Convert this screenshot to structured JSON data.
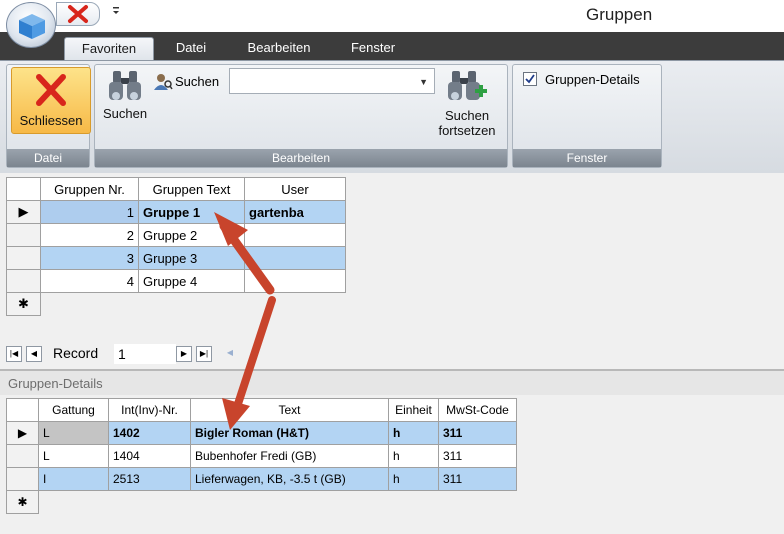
{
  "window": {
    "title": "Gruppen"
  },
  "tabs": [
    {
      "label": "Favoriten",
      "active": true
    },
    {
      "label": "Datei",
      "active": false
    },
    {
      "label": "Bearbeiten",
      "active": false
    },
    {
      "label": "Fenster",
      "active": false
    }
  ],
  "ribbon": {
    "datei": {
      "group_label": "Datei",
      "close_button": "Schliessen"
    },
    "bearbeiten": {
      "group_label": "Bearbeiten",
      "search_button": "Suchen",
      "search_label": "Suchen",
      "search_value": "",
      "continue_search_line1": "Suchen",
      "continue_search_line2": "fortsetzen"
    },
    "fenster": {
      "group_label": "Fenster",
      "details_checkbox": "Gruppen-Details",
      "details_checked": true
    }
  },
  "groups_grid": {
    "columns": [
      "Gruppen Nr.",
      "Gruppen Text",
      "User"
    ],
    "rows": [
      {
        "nr": "1",
        "text": "Gruppe 1",
        "user": "gartenba",
        "selected": true
      },
      {
        "nr": "2",
        "text": "Gruppe 2",
        "user": ""
      },
      {
        "nr": "3",
        "text": "Gruppe 3",
        "user": ""
      },
      {
        "nr": "4",
        "text": "Gruppe 4",
        "user": ""
      }
    ],
    "new_row_marker": "✱",
    "current_row_marker": "▶"
  },
  "navigator": {
    "label": "Record",
    "value": "1"
  },
  "details": {
    "title": "Gruppen-Details",
    "columns": [
      "Gattung",
      "Int(Inv)-Nr.",
      "Text",
      "Einheit",
      "MwSt-Code"
    ],
    "rows": [
      {
        "gattung": "L",
        "nr": "1402",
        "text": "Bigler Roman (H&T)",
        "einheit": "h",
        "mwst": "311",
        "selected": true
      },
      {
        "gattung": "L",
        "nr": "1404",
        "text": "Bubenhofer Fredi (GB)",
        "einheit": "h",
        "mwst": "311"
      },
      {
        "gattung": "I",
        "nr": "2513",
        "text": "Lieferwagen, KB, -3.5 t (GB)",
        "einheit": "h",
        "mwst": "311"
      }
    ]
  },
  "colors": {
    "selection": "#b3d4f3",
    "ribbon_accent": "#f7b947",
    "annotation_arrow": "#c8442c"
  },
  "icons": [
    "app-orb-icon",
    "close-x-icon",
    "binoculars-icon",
    "user-search-icon",
    "binoculars-plus-icon",
    "checkbox-check-icon"
  ]
}
